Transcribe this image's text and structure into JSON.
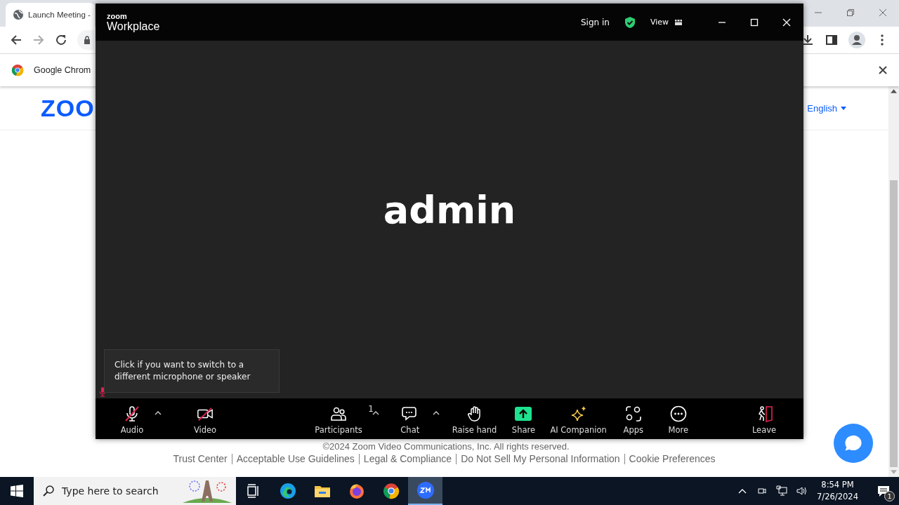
{
  "browser": {
    "tab": {
      "title": "Launch Meeting -",
      "selected": true
    },
    "infobar": {
      "text": "Google Chrom"
    },
    "page": {
      "logo": "ZOO",
      "language": "English",
      "copyright": "©2024 Zoom Video Communications, Inc. All rights reserved.",
      "footer_links": [
        "Trust Center",
        "Acceptable Use Guidelines",
        "Legal & Compliance",
        "Do Not Sell My Personal Information",
        "Cookie Preferences"
      ]
    }
  },
  "zoom_window": {
    "brand_small": "zoom",
    "brand": "Workplace",
    "sign_in": "Sign in",
    "view": "View",
    "participant_name": "admin",
    "tooltip": "Click if you want to switch to a different microphone or speaker",
    "toolbar": [
      {
        "kind": "audio",
        "label": "Audio",
        "muted": true,
        "caret": true
      },
      {
        "kind": "video",
        "label": "Video",
        "muted": true,
        "caret": false
      },
      {
        "kind": "participants",
        "label": "Participants",
        "count": "1",
        "caret": true
      },
      {
        "kind": "chat",
        "label": "Chat",
        "caret": true
      },
      {
        "kind": "raise",
        "label": "Raise hand",
        "caret": false
      },
      {
        "kind": "share",
        "label": "Share",
        "caret": false
      },
      {
        "kind": "ai",
        "label": "AI Companion",
        "caret": false
      },
      {
        "kind": "apps",
        "label": "Apps",
        "caret": false
      },
      {
        "kind": "more",
        "label": "More",
        "caret": false
      },
      {
        "kind": "leave",
        "label": "Leave",
        "caret": false
      }
    ]
  },
  "taskbar": {
    "search_placeholder": "Type here to search",
    "time": "8:54 PM",
    "date": "7/26/2024",
    "notifications": "1",
    "apps": [
      {
        "kind": "taskview",
        "selected": false
      },
      {
        "kind": "edge",
        "selected": false
      },
      {
        "kind": "files",
        "selected": false
      },
      {
        "kind": "firefox",
        "selected": false
      },
      {
        "kind": "chrome",
        "selected": false
      },
      {
        "kind": "zoom",
        "selected": true
      }
    ]
  }
}
